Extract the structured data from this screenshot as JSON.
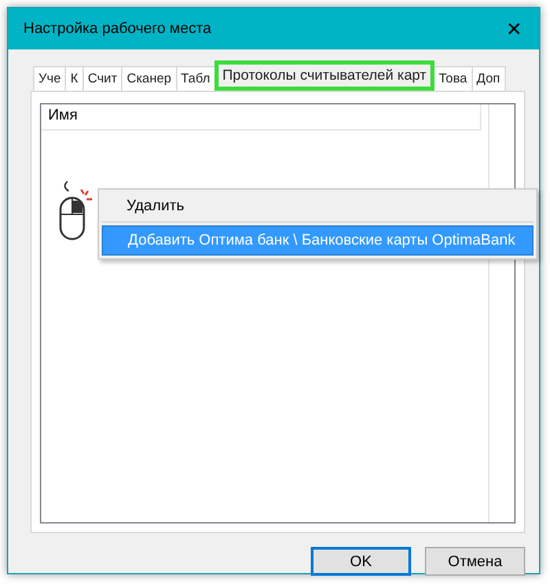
{
  "window": {
    "title": "Настройка рабочего места",
    "close": "✕"
  },
  "tabs": [
    {
      "label": "Уче",
      "selected": false
    },
    {
      "label": "К",
      "selected": false
    },
    {
      "label": "Счит",
      "selected": false
    },
    {
      "label": "Сканер",
      "selected": false
    },
    {
      "label": "Табл",
      "selected": false
    },
    {
      "label": "Протоколы считывателей карт",
      "selected": true
    },
    {
      "label": "Това",
      "selected": false
    },
    {
      "label": "Доп",
      "selected": false
    }
  ],
  "list": {
    "columns": [
      "Имя"
    ]
  },
  "context_menu": {
    "items": [
      {
        "label": "Удалить",
        "selected": false
      },
      {
        "label": "Добавить Оптима банк \\ Банковские карты OptimaBank",
        "selected": true
      }
    ]
  },
  "buttons": [
    {
      "label": "OK",
      "default": true
    },
    {
      "label": "Отмена",
      "default": false
    }
  ]
}
